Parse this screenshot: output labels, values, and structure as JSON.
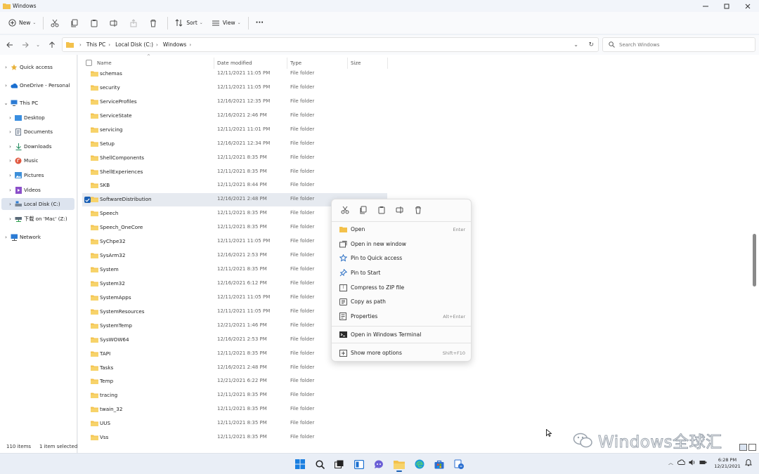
{
  "window": {
    "title": "Windows"
  },
  "toolbar": {
    "new_label": "New",
    "sort_label": "Sort",
    "view_label": "View",
    "more_label": "···"
  },
  "address": {
    "crumbs": [
      "This PC",
      "Local Disk (C:)",
      "Windows"
    ],
    "search_placeholder": "Search Windows"
  },
  "sidebar": {
    "items": [
      {
        "label": "Quick access",
        "icon": "star-icon"
      },
      {
        "label": "OneDrive - Personal",
        "icon": "cloud-icon"
      },
      {
        "label": "This PC",
        "icon": "monitor-icon"
      },
      {
        "label": "Desktop",
        "icon": "desktop-icon"
      },
      {
        "label": "Documents",
        "icon": "documents-icon"
      },
      {
        "label": "Downloads",
        "icon": "downloads-icon"
      },
      {
        "label": "Music",
        "icon": "music-icon"
      },
      {
        "label": "Pictures",
        "icon": "pictures-icon"
      },
      {
        "label": "Videos",
        "icon": "videos-icon"
      },
      {
        "label": "Local Disk (C:)",
        "icon": "drive-icon"
      },
      {
        "label": "下载 on 'Mac' (Z:)",
        "icon": "network-drive-icon"
      },
      {
        "label": "Network",
        "icon": "network-icon"
      }
    ]
  },
  "columns": {
    "name": "Name",
    "date": "Date modified",
    "type": "Type",
    "size": "Size"
  },
  "files": [
    {
      "name": "schemas",
      "date": "12/11/2021 11:05 PM",
      "type": "File folder"
    },
    {
      "name": "security",
      "date": "12/11/2021 11:05 PM",
      "type": "File folder"
    },
    {
      "name": "ServiceProfiles",
      "date": "12/16/2021 12:35 PM",
      "type": "File folder"
    },
    {
      "name": "ServiceState",
      "date": "12/16/2021 2:46 PM",
      "type": "File folder"
    },
    {
      "name": "servicing",
      "date": "12/11/2021 11:01 PM",
      "type": "File folder"
    },
    {
      "name": "Setup",
      "date": "12/16/2021 12:34 PM",
      "type": "File folder"
    },
    {
      "name": "ShellComponents",
      "date": "12/11/2021 8:35 PM",
      "type": "File folder"
    },
    {
      "name": "ShellExperiences",
      "date": "12/11/2021 8:35 PM",
      "type": "File folder"
    },
    {
      "name": "SKB",
      "date": "12/11/2021 8:44 PM",
      "type": "File folder"
    },
    {
      "name": "SoftwareDistribution",
      "date": "12/16/2021 2:48 PM",
      "type": "File folder"
    },
    {
      "name": "Speech",
      "date": "12/11/2021 8:35 PM",
      "type": "File folder"
    },
    {
      "name": "Speech_OneCore",
      "date": "12/11/2021 8:35 PM",
      "type": "File folder"
    },
    {
      "name": "SyChpe32",
      "date": "12/11/2021 11:05 PM",
      "type": "File folder"
    },
    {
      "name": "SysArm32",
      "date": "12/16/2021 2:53 PM",
      "type": "File folder"
    },
    {
      "name": "System",
      "date": "12/11/2021 8:35 PM",
      "type": "File folder"
    },
    {
      "name": "System32",
      "date": "12/16/2021 6:12 PM",
      "type": "File folder"
    },
    {
      "name": "SystemApps",
      "date": "12/11/2021 11:05 PM",
      "type": "File folder"
    },
    {
      "name": "SystemResources",
      "date": "12/11/2021 11:05 PM",
      "type": "File folder"
    },
    {
      "name": "SystemTemp",
      "date": "12/21/2021 1:46 PM",
      "type": "File folder"
    },
    {
      "name": "SysWOW64",
      "date": "12/16/2021 2:53 PM",
      "type": "File folder"
    },
    {
      "name": "TAPI",
      "date": "12/11/2021 8:35 PM",
      "type": "File folder"
    },
    {
      "name": "Tasks",
      "date": "12/16/2021 2:48 PM",
      "type": "File folder"
    },
    {
      "name": "Temp",
      "date": "12/21/2021 6:22 PM",
      "type": "File folder"
    },
    {
      "name": "tracing",
      "date": "12/11/2021 8:35 PM",
      "type": "File folder"
    },
    {
      "name": "twain_32",
      "date": "12/11/2021 8:35 PM",
      "type": "File folder"
    },
    {
      "name": "UUS",
      "date": "12/11/2021 8:35 PM",
      "type": "File folder"
    },
    {
      "name": "Vss",
      "date": "12/11/2021 8:35 PM",
      "type": "File folder"
    }
  ],
  "context_menu": {
    "quick_actions": [
      "cut-icon",
      "copy-icon",
      "paste-icon",
      "rename-icon",
      "delete-icon"
    ],
    "items": [
      {
        "label": "Open",
        "shortcut": "Enter"
      },
      {
        "label": "Open in new window",
        "shortcut": ""
      },
      {
        "label": "Pin to Quick access",
        "shortcut": ""
      },
      {
        "label": "Pin to Start",
        "shortcut": ""
      },
      {
        "label": "Compress to ZIP file",
        "shortcut": ""
      },
      {
        "label": "Copy as path",
        "shortcut": ""
      },
      {
        "label": "Properties",
        "shortcut": "Alt+Enter"
      },
      {
        "label": "Open in Windows Terminal",
        "shortcut": ""
      },
      {
        "label": "Show more options",
        "shortcut": "Shift+F10"
      }
    ]
  },
  "status": {
    "item_count": "110 items",
    "selected": "1 item selected"
  },
  "taskbar": {
    "time": "6:28 PM",
    "date": "12/21/2021"
  },
  "watermark": {
    "text": "Windows全球汇"
  },
  "colors": {
    "accent": "#1a5fb4",
    "folder": "#f3c14b",
    "selected_row": "#e6eaf0"
  }
}
